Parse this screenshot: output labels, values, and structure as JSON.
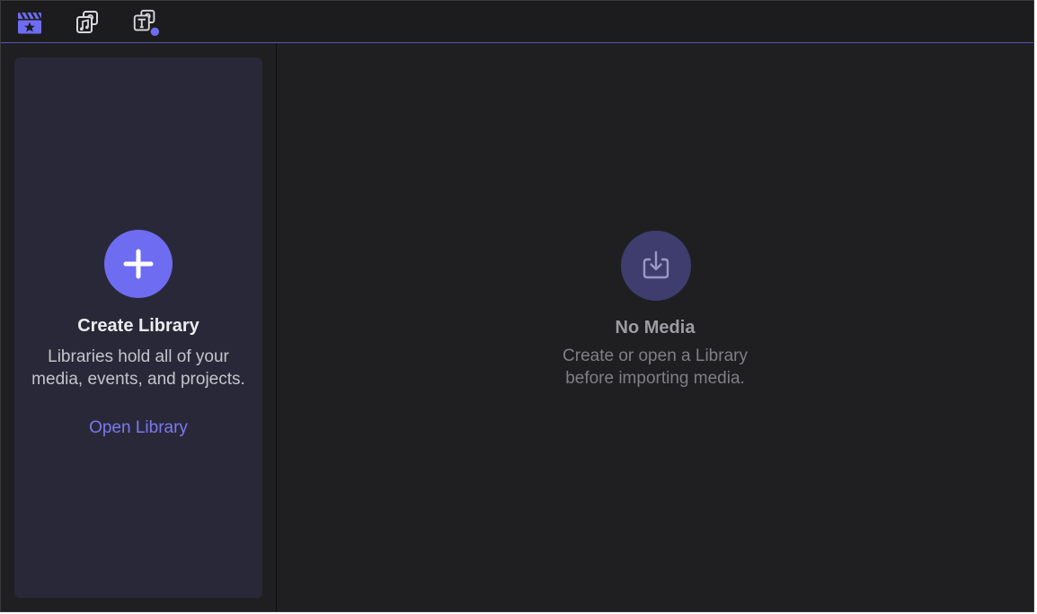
{
  "toolbar": {
    "buttons": [
      {
        "icon": "clapper-star-icon",
        "label": "Libraries"
      },
      {
        "icon": "photos-music-icon",
        "label": "Photos and Audio"
      },
      {
        "icon": "titles-generators-icon",
        "label": "Titles and Generators"
      }
    ]
  },
  "sidebar": {
    "card": {
      "title": "Create Library",
      "description_line1": "Libraries hold all of your",
      "description_line2": "media, events, and projects.",
      "open_link": "Open Library"
    }
  },
  "main": {
    "title": "No Media",
    "description_line1": "Create or open a Library",
    "description_line2": "before importing media."
  },
  "colors": {
    "accent": "#6e6cf0",
    "link": "#7b79ef",
    "card_background": "#292838",
    "window_background": "#1f1f21",
    "import_circle": "#3f3d6e"
  }
}
